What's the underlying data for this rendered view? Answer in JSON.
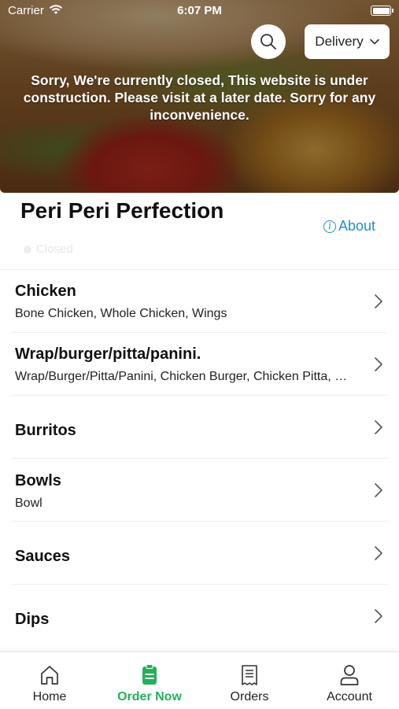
{
  "status_bar": {
    "carrier": "Carrier",
    "time": "6:07 PM"
  },
  "header": {
    "delivery_label": "Delivery",
    "closed_message": "Sorry, We're currently closed, This website is under construction. Please visit at a later date. Sorry for any inconvenience."
  },
  "restaurant": {
    "name": "Peri Peri Perfection",
    "about_label": "About",
    "status_label": "Closed"
  },
  "menu": {
    "categories": [
      {
        "title": "Chicken",
        "subtitle": "Bone Chicken, Whole Chicken, Wings"
      },
      {
        "title": "Wrap/burger/pitta/panini.",
        "subtitle": "Wrap/Burger/Pitta/Panini, Chicken Burger, Chicken Pitta, Chicken Panini"
      },
      {
        "title": "Burritos",
        "subtitle": ""
      },
      {
        "title": "Bowls",
        "subtitle": "Bowl"
      },
      {
        "title": "Sauces",
        "subtitle": ""
      },
      {
        "title": "Dips",
        "subtitle": ""
      }
    ]
  },
  "tabbar": {
    "tabs": [
      {
        "label": "Home",
        "icon": "home-icon"
      },
      {
        "label": "Order Now",
        "icon": "order-icon",
        "active": true
      },
      {
        "label": "Orders",
        "icon": "receipt-icon"
      },
      {
        "label": "Account",
        "icon": "account-icon"
      }
    ]
  },
  "colors": {
    "accent_green": "#22b25a",
    "link_blue": "#1f8fd6"
  }
}
